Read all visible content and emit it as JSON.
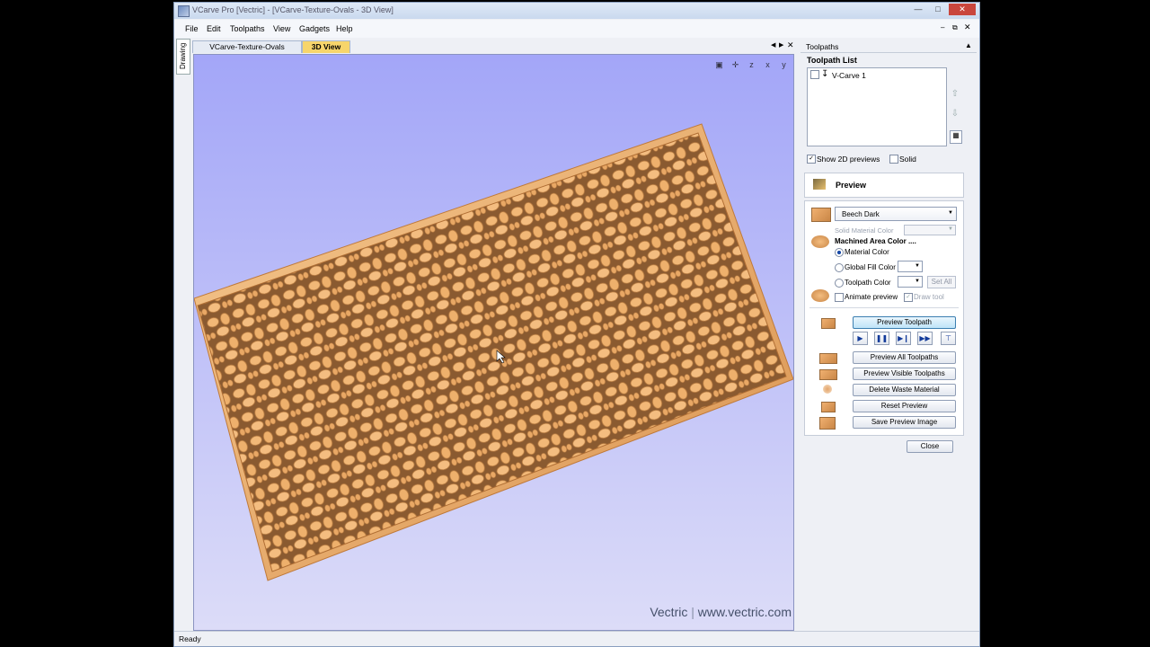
{
  "window": {
    "title": "VCarve Pro [Vectric] - [VCarve-Texture-Ovals - 3D View]"
  },
  "menu": [
    "File",
    "Edit",
    "Toolpaths",
    "View",
    "Gadgets",
    "Help"
  ],
  "left_tab": "Drawing",
  "doc_tabs": [
    "VCarve-Texture-Ovals",
    "3D View"
  ],
  "view": {
    "watermark_brand": "Vectric",
    "watermark_url": "www.vectric.com"
  },
  "panel": {
    "header": "Toolpaths",
    "list_title": "Toolpath List",
    "toolpaths": [
      "V-Carve 1"
    ],
    "show_2d_label": "Show 2D previews",
    "solid_label": "Solid",
    "preview_title": "Preview",
    "material": "Beech Dark",
    "solid_material_color_label": "Solid Material Color",
    "machined_area_label": "Machined Area Color ....",
    "radio_material": "Material Color",
    "radio_global": "Global Fill Color",
    "radio_toolpath": "Toolpath Color",
    "set_all": "Set All",
    "animate_label": "Animate preview",
    "draw_tool_label": "Draw tool",
    "btn_preview_toolpath": "Preview Toolpath",
    "btn_preview_all": "Preview All Toolpaths",
    "btn_preview_visible": "Preview Visible Toolpaths",
    "btn_delete_waste": "Delete Waste Material",
    "btn_reset": "Reset Preview",
    "btn_save_image": "Save Preview Image",
    "btn_close": "Close"
  },
  "status": "Ready",
  "colors": {
    "wood_light": "#f2b877",
    "wood_dark": "#8a5a30",
    "view_bg_top": "#a3a6f8",
    "view_bg_bottom": "#dcdcf8"
  }
}
